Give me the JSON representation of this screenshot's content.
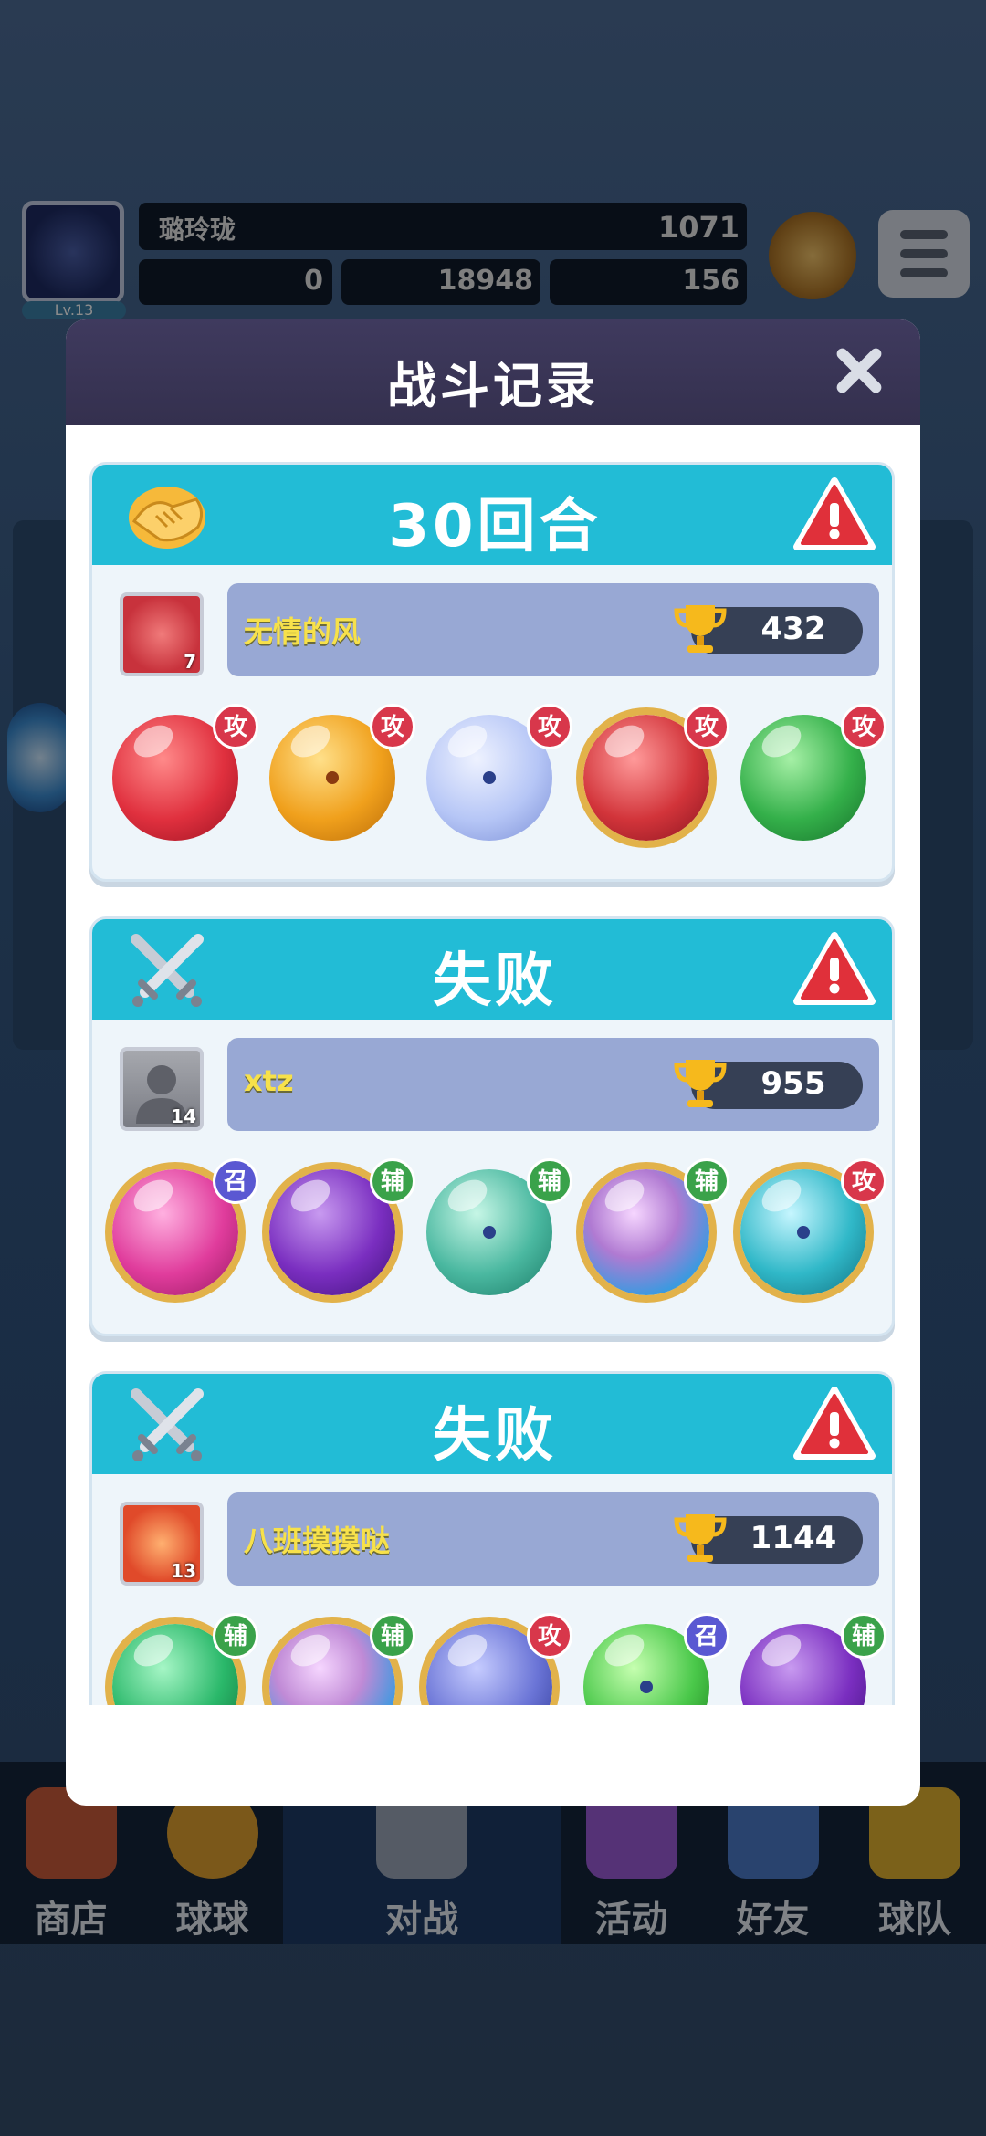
{
  "background": {
    "player_name": "璐玲珑",
    "level": "Lv.13",
    "trophies": "1071",
    "resources": [
      "0",
      "18948",
      "156"
    ]
  },
  "bottom_nav": [
    {
      "label": "商店",
      "icon": "shop-icon"
    },
    {
      "label": "球球",
      "icon": "ball-icon"
    },
    {
      "label": "对战",
      "icon": "battle-icon",
      "active": true
    },
    {
      "label": "活动",
      "icon": "party-icon"
    },
    {
      "label": "好友",
      "icon": "friends-icon"
    },
    {
      "label": "球队",
      "icon": "whistle-icon"
    }
  ],
  "modal": {
    "title": "战斗记录",
    "records": [
      {
        "result": "30回合",
        "result_icon": "handshake-icon",
        "player": {
          "name": "无情的风",
          "level": "7",
          "trophies": "432",
          "avatar_color": "#c8323c"
        },
        "balls": [
          {
            "color": "#e0303e",
            "role": "攻",
            "icon": "fire-ball-icon"
          },
          {
            "color": "#f0a01c",
            "role": "攻",
            "icon": "lightning-ball-icon"
          },
          {
            "color": "#b6c6f6",
            "role": "攻",
            "icon": "bubble-ball-icon"
          },
          {
            "color": "#d2343a",
            "role": "攻",
            "icon": "fist-ball-icon"
          },
          {
            "color": "#34b04a",
            "role": "攻",
            "icon": "poison-ball-icon"
          }
        ]
      },
      {
        "result": "失败",
        "result_icon": "crossed-swords-icon",
        "player": {
          "name": "xtz",
          "level": "14",
          "trophies": "955",
          "avatar_color": "#8a8c92"
        },
        "balls": [
          {
            "color": "#e03c9c",
            "role": "召",
            "icon": "fish-ball-icon"
          },
          {
            "color": "#7a2ec0",
            "role": "辅",
            "icon": "sprout-ball-icon"
          },
          {
            "color": "#4ab8a0",
            "role": "辅",
            "icon": "sp-ball-icon"
          },
          {
            "color": "#b07ad2",
            "role": "辅",
            "icon": "prism-ball-icon"
          },
          {
            "color": "#30b8c8",
            "role": "攻",
            "icon": "tornado-ball-icon"
          }
        ]
      },
      {
        "result": "失败",
        "result_icon": "crossed-swords-icon",
        "player": {
          "name": "八班摸摸哒",
          "level": "13",
          "trophies": "1144",
          "avatar_color": "#e04a2a"
        },
        "balls": [
          {
            "color": "#2ab86a",
            "role": "辅",
            "icon": "star-ball-icon"
          },
          {
            "color": "#c08ad6",
            "role": "辅",
            "icon": "prism-ball-icon"
          },
          {
            "color": "#6a74d6",
            "role": "攻",
            "icon": "maze-ball-icon"
          },
          {
            "color": "#4ac84a",
            "role": "召",
            "icon": "rune-ball-icon"
          },
          {
            "color": "#7a2ec0",
            "role": "辅",
            "icon": "sprout-ball-icon"
          }
        ]
      }
    ]
  }
}
